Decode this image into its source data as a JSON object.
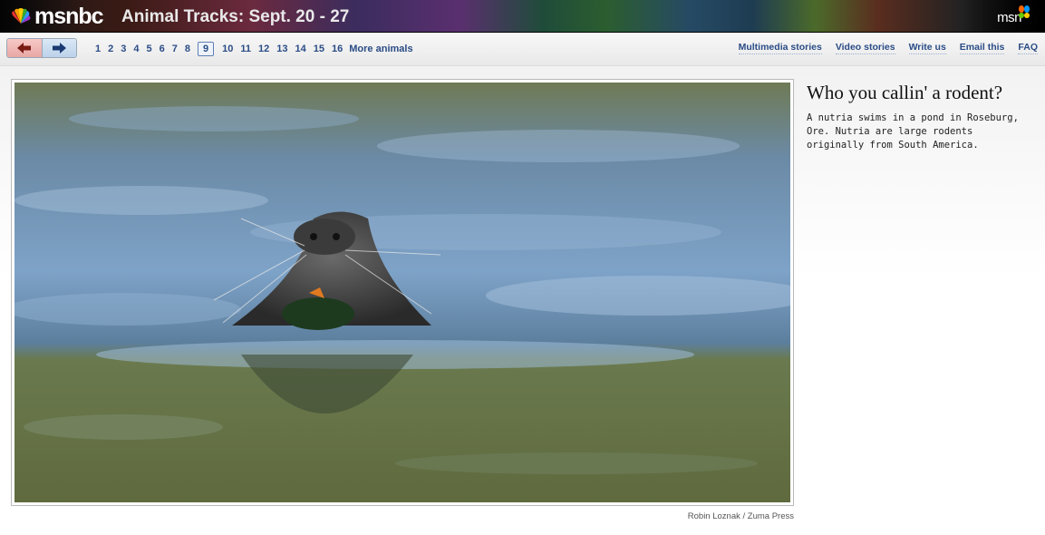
{
  "header": {
    "brand": "msnbc",
    "title": "Animal Tracks: Sept. 20 - 27",
    "partner": "msn"
  },
  "nav": {
    "prev_icon": "arrow-left-icon",
    "next_icon": "arrow-right-icon",
    "pages": [
      "1",
      "2",
      "3",
      "4",
      "5",
      "6",
      "7",
      "8",
      "9",
      "10",
      "11",
      "12",
      "13",
      "14",
      "15",
      "16"
    ],
    "current_page": "9",
    "more_label": "More animals",
    "links": [
      "Multimedia stories",
      "Video stories",
      "Write us",
      "Email this",
      "FAQ"
    ]
  },
  "slide": {
    "headline": "Who you callin' a rodent?",
    "caption": "A nutria swims in a pond in Roseburg, Ore. Nutria are large rodents originally from South America.",
    "credit": "Robin Loznak / Zuma Press"
  },
  "colors": {
    "link": "#2a4c86",
    "water_light": "#7da0c5",
    "water_dark": "#6e7d4f"
  }
}
